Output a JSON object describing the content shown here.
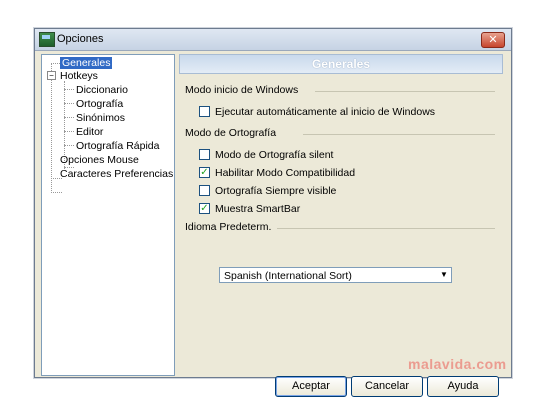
{
  "window": {
    "title": "Opciones",
    "close_symbol": "✕"
  },
  "tree": {
    "items": [
      {
        "label": "Generales",
        "selected": true
      },
      {
        "label": "Hotkeys",
        "expander": "−"
      },
      {
        "label": "Diccionario"
      },
      {
        "label": "Ortografía"
      },
      {
        "label": "Sinónimos"
      },
      {
        "label": "Editor"
      },
      {
        "label": "Ortografía Rápida"
      },
      {
        "label": "Opciones Mouse"
      },
      {
        "label": "Caracteres Preferencias"
      }
    ]
  },
  "panel": {
    "header": "Generales",
    "section_windows": "Modo inicio de Windows",
    "autostart": {
      "label": "Ejecutar automáticamente al inicio de Windows",
      "checked": false
    },
    "section_ortografia": "Modo de Ortografía",
    "options": [
      {
        "label": "Modo de Ortografía silent",
        "checked": false
      },
      {
        "label": "Habilitar Modo Compatibilidad",
        "checked": true
      },
      {
        "label": "Ortografía Siempre visible",
        "checked": false
      },
      {
        "label": "Muestra SmartBar",
        "checked": true
      }
    ],
    "section_idioma": "Idioma Predeterm.",
    "language_value": "Spanish (International Sort)"
  },
  "buttons": {
    "accept": "Aceptar",
    "cancel": "Cancelar",
    "help": "Ayuda"
  },
  "watermark": "malavida.com",
  "icons": {
    "app": "app-window-icon",
    "close": "close-icon",
    "check": "✓",
    "dropdown": "▼"
  },
  "colors": {
    "selection": "#316ac5",
    "check": "#21a121",
    "window_bg": "#ece9d8"
  }
}
